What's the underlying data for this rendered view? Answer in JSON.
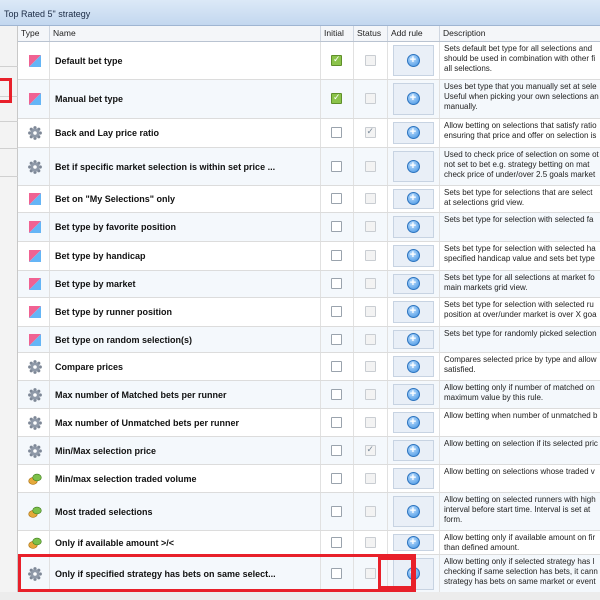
{
  "window": {
    "title": "Top Rated 5\" strategy"
  },
  "columns": {
    "type": "Type",
    "name": "Name",
    "initial": "Initial",
    "status": "Status",
    "add_rule": "Add rule",
    "description": "Description"
  },
  "icons": {
    "bet_type": "bet-type-icon",
    "condition": "gear-icon",
    "money": "coins-icon",
    "add": "add-rule-icon"
  },
  "colors": {
    "highlight": "#e8202a",
    "header_bg": "#c3d7ef",
    "check_green": "#8bc34a",
    "add_blue": "#3c8ee0"
  },
  "rows": [
    {
      "name": "Default bet type",
      "icon": "bet-type-icon",
      "initial": "checked",
      "status": "disabled",
      "desc": [
        "Sets default bet type for all selections and",
        "should be used in combination with other fi",
        "all selections."
      ]
    },
    {
      "name": "Manual bet type",
      "icon": "bet-type-icon",
      "initial": "checked",
      "status": "disabled",
      "desc": [
        "Uses bet type that you manually set at sele",
        "Useful when picking your own selections an",
        "manually."
      ]
    },
    {
      "name": "Back and Lay price ratio",
      "icon": "gear-icon",
      "initial": "unchecked",
      "status": "checked",
      "desc": [
        "Allow betting on selections that satisfy ratio",
        "ensuring that price and offer on selection is"
      ]
    },
    {
      "name": "Bet if specific market selection is within set price ...",
      "icon": "gear-icon",
      "initial": "unchecked",
      "status": "unchecked",
      "desc": [
        "Used to check price of selection on some ot",
        "not set to bet e.g. strategy betting on mat",
        "check price of under/over 2.5 goals market"
      ]
    },
    {
      "name": "Bet on \"My Selections\" only",
      "icon": "bet-type-icon",
      "initial": "unchecked",
      "status": "unchecked",
      "desc": [
        "Sets bet type for selections that are select",
        "at selections grid view."
      ]
    },
    {
      "name": "Bet type by favorite position",
      "icon": "bet-type-icon",
      "initial": "unchecked",
      "status": "unchecked",
      "desc": [
        "Sets bet type for selection with selected fa"
      ]
    },
    {
      "name": "Bet type by handicap",
      "icon": "bet-type-icon",
      "initial": "unchecked",
      "status": "unchecked",
      "desc": [
        "Sets bet type for selection with selected ha",
        "specified handicap value and sets bet type"
      ]
    },
    {
      "name": "Bet type by market",
      "icon": "bet-type-icon",
      "initial": "unchecked",
      "status": "unchecked",
      "desc": [
        "Sets bet type for all selections at market fo",
        "main markets grid view."
      ]
    },
    {
      "name": "Bet type by runner position",
      "icon": "bet-type-icon",
      "initial": "unchecked",
      "status": "unchecked",
      "desc": [
        "Sets bet type for selection with selected ru",
        "position at over/under market is over X goa"
      ]
    },
    {
      "name": "Bet type on random selection(s)",
      "icon": "bet-type-icon",
      "initial": "unchecked",
      "status": "unchecked",
      "desc": [
        "Sets bet type for randomly picked selection"
      ]
    },
    {
      "name": "Compare prices",
      "icon": "gear-icon",
      "initial": "unchecked",
      "status": "unchecked",
      "desc": [
        "Compares selected price by type and allow",
        "satisfied."
      ]
    },
    {
      "name": "Max number of Matched bets per runner",
      "icon": "gear-icon",
      "initial": "unchecked",
      "status": "unchecked",
      "desc": [
        "Allow betting only if number of matched on",
        "maximum value by this rule."
      ]
    },
    {
      "name": "Max number of Unmatched bets per runner",
      "icon": "gear-icon",
      "initial": "unchecked",
      "status": "unchecked",
      "desc": [
        "Allow betting when number of unmatched b"
      ]
    },
    {
      "name": "Min/Max selection price",
      "icon": "gear-icon",
      "initial": "unchecked",
      "status": "checked",
      "desc": [
        "Allow betting on selection if its selected pric"
      ]
    },
    {
      "name": "Min/max selection traded volume",
      "icon": "coins-icon",
      "initial": "unchecked",
      "status": "unchecked",
      "desc": [
        "Allow betting on selections whose traded v"
      ]
    },
    {
      "name": "Most traded selections",
      "icon": "coins-icon",
      "initial": "unchecked",
      "status": "unchecked",
      "desc": [
        "Allow betting on selected runners with high",
        "interval before start time. Interval is set at",
        "form."
      ]
    },
    {
      "name": "Only if available amount >/<",
      "icon": "coins-icon",
      "initial": "unchecked",
      "status": "unchecked",
      "desc": [
        "Allow betting only if available amount on fir",
        "than defined amount."
      ]
    },
    {
      "name": "Only if specified strategy has bets on same select...",
      "icon": "gear-icon",
      "initial": "unchecked",
      "status": "unchecked",
      "desc": [
        "Allow betting only if selected strategy has l",
        "checking if same selection has bets, it cann",
        "strategy has bets on same market or event"
      ]
    }
  ]
}
